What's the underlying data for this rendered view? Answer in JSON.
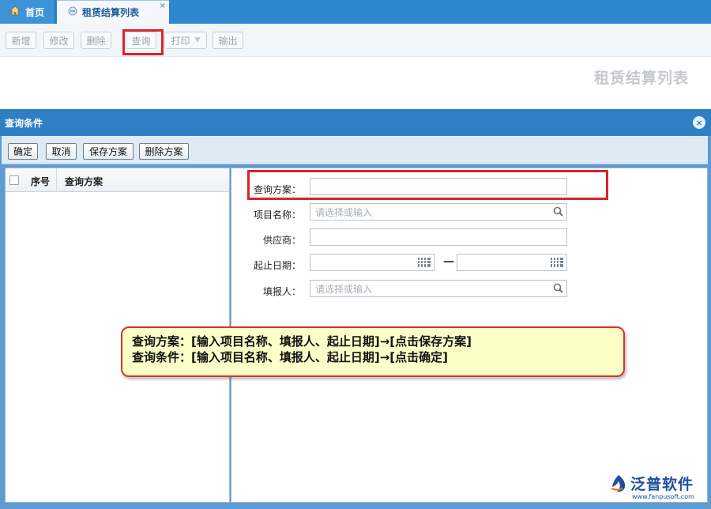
{
  "tabs": {
    "home_label": "首页",
    "active_label": "租赁结算列表",
    "close_glyph": "×"
  },
  "toolbar": {
    "new_label": "新增",
    "edit_label": "修改",
    "delete_label": "删除",
    "query_label": "查询",
    "print_label": "打印",
    "export_label": "输出"
  },
  "page": {
    "heading": "租赁结算列表"
  },
  "dialog": {
    "title": "查询条件",
    "close_glyph": "×",
    "buttons": {
      "confirm": "确定",
      "cancel": "取消",
      "save_plan": "保存方案",
      "delete_plan": "删除方案"
    },
    "plan_list": {
      "col_index": "序号",
      "col_plan": "查询方案"
    },
    "form": {
      "plan_label": "查询方案：",
      "plan_value": "",
      "project_label": "项目名称：",
      "project_placeholder": "请选择或输入",
      "supplier_label": "供应商：",
      "supplier_value": "",
      "date_label": "起止日期：",
      "date_separator": "—",
      "reporter_label": "填报人：",
      "reporter_placeholder": "请选择或输入"
    }
  },
  "note": {
    "line1": "查询方案：[输入项目名称、填报人、起止日期]→[点击保存方案]",
    "line2": "查询条件：[输入项目名称、填报人、起止日期]→[点击确定]"
  },
  "logo": {
    "name": "泛普软件",
    "url": "www.fanpusoft.com"
  },
  "colors": {
    "tabbar": "#2e86cf",
    "dialog_title": "#2f7fc4",
    "highlight": "#d6262b",
    "note_bg": "#fefec8"
  }
}
